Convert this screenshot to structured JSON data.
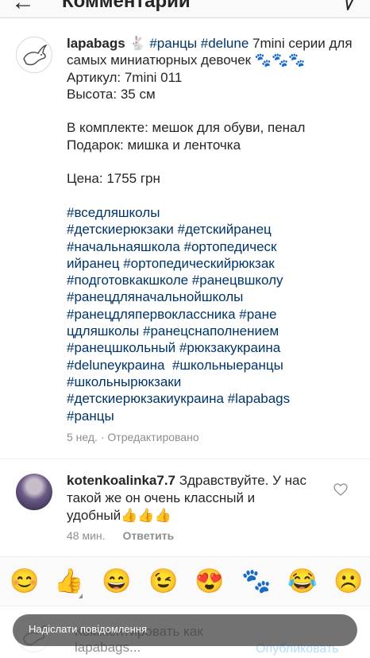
{
  "header": {
    "title": "Комментарии",
    "back_icon": "arrow-left-icon",
    "send_icon": "paper-plane-icon"
  },
  "post": {
    "username": "lapabags",
    "rabbit_emoji": "🐇",
    "caption_line1_tags": "#ранцы #delune",
    "caption_line1_text": " 7mini серии для самых миниатюрных девочек ",
    "paws": "🐾🐾🐾",
    "caption_line2": " Артикул: 7mini 011\nВысота: 35 см\n\nВ комплекте: мешок для обуви, пенал\nПодарок: мишка и ленточка\n\nЦена: 1755 грн\n\n",
    "hashtags": "#вседляшколы\n#детскиерюкзаки #детскийранец\n#начальнаяшкола #ортопедическ\nийранец #ортопедическийрюкзак\n#подготовкакшколе #ранецвшколу\n#ранецдляначальнойшколы\n#ранецдляпервоклассника #ране\nцдляшколы #ранецснаполнением\n#ранецшкольный #рюкзакукраина\n#delunеукраина  #школьныеранцы\n#школьнырюкзаки\n#детскиерюкзакиукраина #lapabags\n#ранцы",
    "time": "5 нед.",
    "edited": "Отредактировано"
  },
  "comment": {
    "username": "kotenkoalinka7.7",
    "text": " Здравствуйте. У нас такой же он очень классный и удобный👍👍👍",
    "time": "48 мин.",
    "reply_label": "Ответить",
    "like_icon": "heart-outline-icon"
  },
  "emoji_bar": [
    "😊",
    "👍",
    "😄",
    "😉",
    "😍",
    "🐾",
    "😂",
    "☹️"
  ],
  "input": {
    "placeholder": "Комментировать как lapabags...",
    "publish_label": "Опубликовать",
    "toast": "Надіслати повідомлення"
  },
  "colors": {
    "hashtag": "#003569",
    "muted": "#8e8e8e",
    "publish_disabled": "#b2dffc"
  }
}
